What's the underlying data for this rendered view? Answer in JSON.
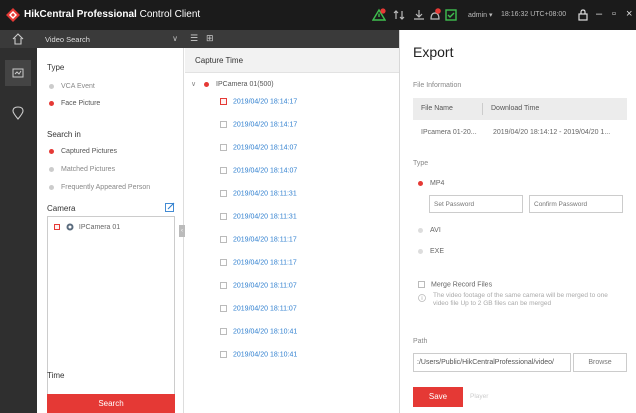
{
  "titlebar": {
    "brand": "HikCentral Professional",
    "suffix": " Control Client",
    "user": "admin",
    "time": "18:16:32 UTC+08:00",
    "colors": {
      "bar": "#1b1b1b",
      "accent": "#e53935",
      "alarm": "#f5c518",
      "ok": "#3fbf4f"
    }
  },
  "module": {
    "label": "Video Search"
  },
  "search_panel": {
    "type_title": "Type",
    "type_options": [
      {
        "label": "VCA Event",
        "selected": false
      },
      {
        "label": "Face Picture",
        "selected": true
      }
    ],
    "search_in_title": "Search in",
    "search_in_options": [
      {
        "label": "Captured Pictures",
        "selected": true
      },
      {
        "label": "Matched Pictures",
        "selected": false
      },
      {
        "label": "Frequently Appeared Person",
        "selected": false
      }
    ],
    "camera_title": "Camera",
    "camera_item": "IPCamera 01",
    "time_title": "Time",
    "search_button": "Search"
  },
  "results": {
    "header": "Capture Time",
    "group": "IPCamera 01(500)",
    "rows": [
      {
        "time": "2019/04/20 18:14:17",
        "checked": true
      },
      {
        "time": "2019/04/20 18:14:17",
        "checked": false
      },
      {
        "time": "2019/04/20 18:14:07",
        "checked": false
      },
      {
        "time": "2019/04/20 18:14:07",
        "checked": false
      },
      {
        "time": "2019/04/20 18:11:31",
        "checked": false
      },
      {
        "time": "2019/04/20 18:11:31",
        "checked": false
      },
      {
        "time": "2019/04/20 18:11:17",
        "checked": false
      },
      {
        "time": "2019/04/20 18:11:17",
        "checked": false
      },
      {
        "time": "2019/04/20 18:11:07",
        "checked": false
      },
      {
        "time": "2019/04/20 18:11:07",
        "checked": false
      },
      {
        "time": "2019/04/20 18:10:41",
        "checked": false
      },
      {
        "time": "2019/04/20 18:10:41",
        "checked": false
      }
    ]
  },
  "export": {
    "title": "Export",
    "file_info_label": "File Information",
    "col_file_name": "File Name",
    "col_download_time": "Download Time",
    "file_name": "IPcamera 01-20...",
    "download_time": "2019/04/20 18:14:12 - 2019/04/20 1...",
    "type_label": "Type",
    "formats": [
      {
        "label": "MP4",
        "selected": true
      },
      {
        "label": "AVI",
        "selected": false
      },
      {
        "label": "EXE",
        "selected": false
      }
    ],
    "set_password_placeholder": "Set Password",
    "confirm_password_placeholder": "Confirm Password",
    "merge_label": "Merge Record Files",
    "merge_info": "The video footage of the same camera will be merged to one video file Up to 2 GB files can be merged",
    "path_label": "Path",
    "path_value": ":/Users/Public/HikCentralProfessional/video/",
    "browse_button": "Browse",
    "save_button": "Save",
    "player_label": "Player"
  }
}
